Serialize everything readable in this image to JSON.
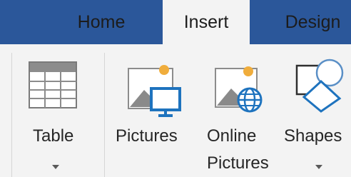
{
  "tabs": [
    {
      "label": "Home"
    },
    {
      "label": "Insert"
    },
    {
      "label": "Design"
    }
  ],
  "ribbon": {
    "table": {
      "label": "Table",
      "icon": "table-icon"
    },
    "pictures": {
      "label": "Pictures",
      "icon": "pictures-icon"
    },
    "online_pictures": {
      "label_line1": "Online",
      "label_line2": "Pictures",
      "icon": "online-pictures-icon"
    },
    "shapes": {
      "label": "Shapes",
      "icon": "shapes-icon"
    }
  },
  "colors": {
    "tab_bar": "#2b579a",
    "ribbon_bg": "#f3f3f3",
    "icon_blue": "#1e73be",
    "sun": "#f0ad3c"
  }
}
